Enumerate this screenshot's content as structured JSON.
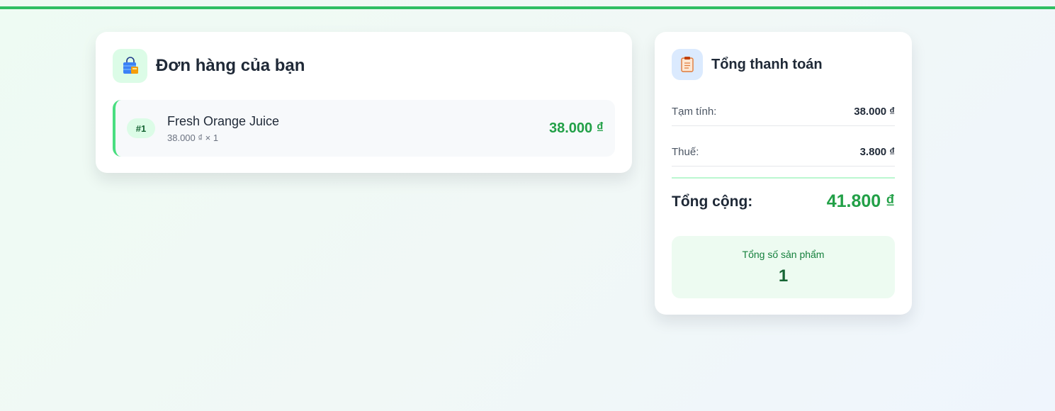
{
  "colors": {
    "accent": "#2fbf63",
    "price_green": "#22a047",
    "badge_bg": "#dcfce7"
  },
  "order": {
    "icon": "shopping-bag-icon",
    "title": "Đơn hàng của bạn",
    "items": [
      {
        "index": "#1",
        "name": "Fresh Orange Juice",
        "meta": "38.000 ₫ × 1",
        "price": "38.000 ₫"
      }
    ]
  },
  "summary": {
    "icon": "clipboard-icon",
    "title": "Tổng thanh toán",
    "subtotal_label": "Tạm tính:",
    "subtotal_value": "38.000 ₫",
    "tax_label": "Thuế:",
    "tax_value": "3.800 ₫",
    "total_label": "Tổng cộng:",
    "total_value": "41.800 ₫",
    "count_label": "Tổng số sản phẩm",
    "count_value": "1"
  }
}
